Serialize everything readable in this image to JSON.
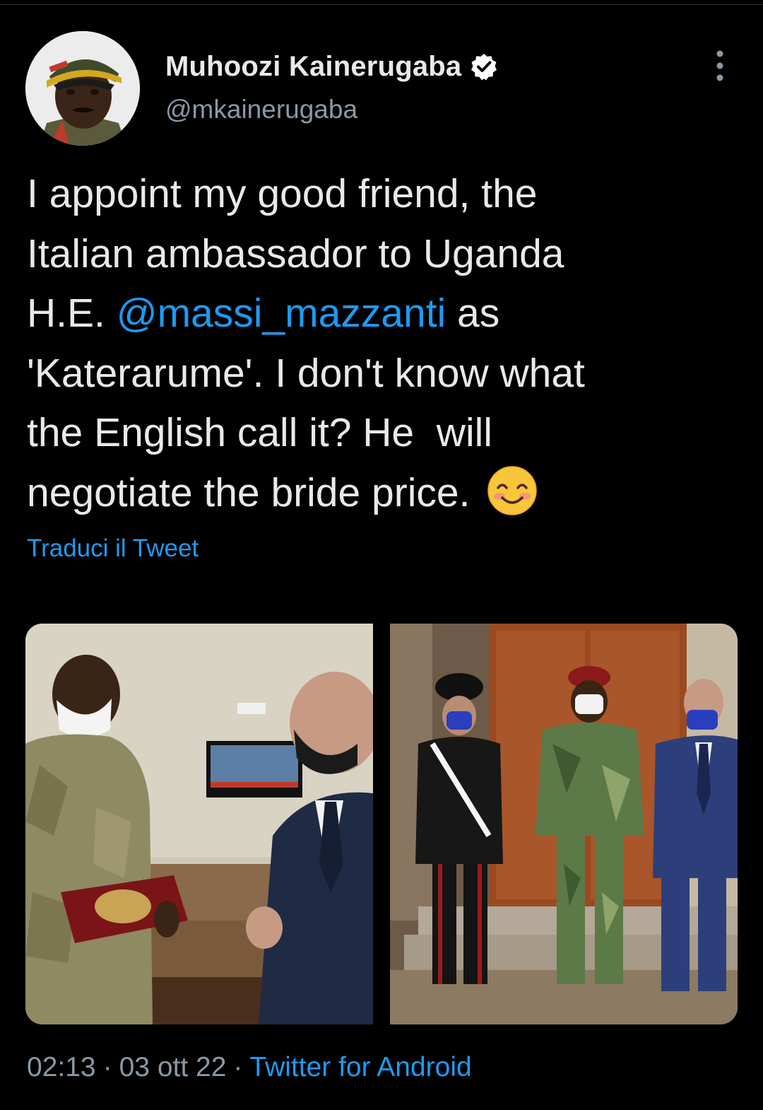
{
  "author": {
    "display_name": "Muhoozi Kainerugaba",
    "handle": "@mkainerugaba",
    "verified": true,
    "avatar_icon": "profile-photo"
  },
  "tweet": {
    "line1": "I appoint my good friend, the",
    "line2": "Italian ambassador to Uganda",
    "line3_prefix": "H.E. ",
    "mention": "@massi_mazzanti",
    "line3_suffix": " as",
    "line4": "'Katerarume'. I don't know what",
    "line5": "the English call it? He  will",
    "line6": "negotiate the bride price.",
    "emoji": "smiling-face-with-smiling-eyes"
  },
  "translate_label": "Traduci il Tweet",
  "media": [
    {
      "kind": "photo",
      "subject": "officer-presenting-plaque"
    },
    {
      "kind": "photo",
      "subject": "three-men-standing-before-door"
    }
  ],
  "meta": {
    "time": "02:13",
    "date": "03 ott 22",
    "separator": "·",
    "source": "Twitter for Android"
  },
  "colors": {
    "background": "#000000",
    "text": "#e7e9ea",
    "muted": "#8b98a5",
    "link": "#1d9bf0"
  }
}
